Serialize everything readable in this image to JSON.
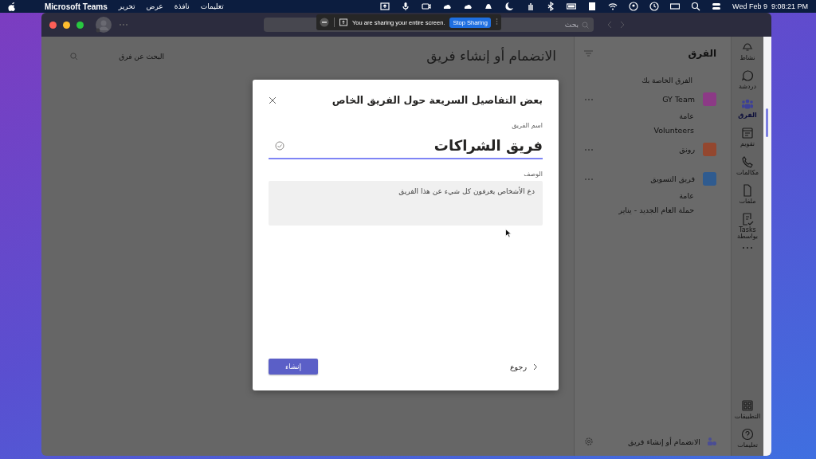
{
  "menu_bar": {
    "app_name": "Microsoft Teams",
    "menus": [
      "تعليمات",
      "نافذة",
      "عرض",
      "تحرير"
    ],
    "clock": "Wed Feb 9  9:08:21 PM"
  },
  "sharing_bar": {
    "message": "You are sharing your entire screen.",
    "stop_button": "Stop Sharing"
  },
  "title_bar": {
    "search_placeholder": "بحث"
  },
  "main": {
    "heading": "الانضمام أو إنشاء فريق",
    "search_placeholder": "البحث عن فرق"
  },
  "sidebar": {
    "title": "الفرق",
    "section": "الفرق الخاصة بك",
    "teams": [
      {
        "name": "GY Team",
        "color": "#8c3a86",
        "channels": [
          "عامة",
          "Volunteers"
        ]
      },
      {
        "name": "رونق",
        "color": "#93472f"
      },
      {
        "name": "فريق التسويق",
        "color": "#2f5b8f",
        "channels": [
          "عامة",
          "حملة العام الجديد - يناير"
        ]
      }
    ],
    "footer": "الانضمام أو إنشاء فريق"
  },
  "rail": [
    {
      "kind": "activity",
      "label": "نشاط",
      "selected": false
    },
    {
      "kind": "chat",
      "label": "دردشة",
      "selected": false
    },
    {
      "kind": "teams",
      "label": "الفرق",
      "selected": true
    },
    {
      "kind": "calendar",
      "label": "تقويم",
      "selected": false
    },
    {
      "kind": "calls",
      "label": "مكالمات",
      "selected": false
    },
    {
      "kind": "files",
      "label": "ملفات",
      "selected": false
    },
    {
      "kind": "tasks",
      "label": "Tasks بواسطة",
      "selected": false
    },
    {
      "kind": "more",
      "selected": false
    },
    {
      "kind": "apps",
      "label": "التطبيقات",
      "selected": false
    },
    {
      "kind": "help",
      "label": "تعليمات",
      "selected": false
    }
  ],
  "dialog": {
    "title": "بعض التفاصيل السريعة حول الفريق الخاص",
    "name_label": "اسم الفريق",
    "name_value": "فريق الشراكات",
    "description_label": "الوصف",
    "description_placeholder": "دع الأشخاص يعرفون كل شيء عن هذا الفريق",
    "create_button": "إنشاء",
    "back_button": "رجوع"
  }
}
